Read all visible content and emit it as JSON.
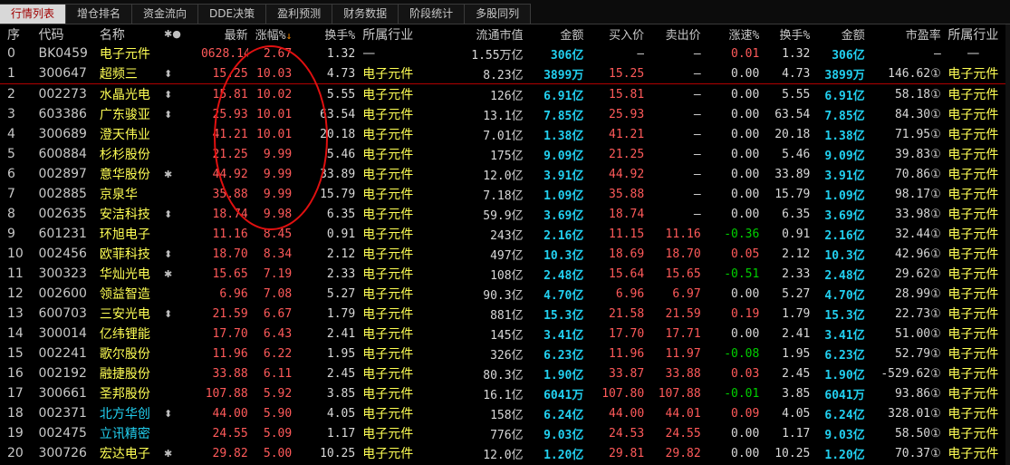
{
  "tabs": [
    {
      "label": "行情列表",
      "active": true
    },
    {
      "label": "增仓排名",
      "active": false
    },
    {
      "label": "资金流向",
      "active": false
    },
    {
      "label": "DDE决策",
      "active": false
    },
    {
      "label": "盈利预测",
      "active": false
    },
    {
      "label": "财务数据",
      "active": false
    },
    {
      "label": "阶段统计",
      "active": false
    },
    {
      "label": "多股同列",
      "active": false
    }
  ],
  "columns": [
    "序",
    "代码",
    "名称",
    "✱●",
    "最新",
    "涨幅%",
    "换手%",
    "所属行业",
    "流通市值",
    "金额",
    "买入价",
    "卖出价",
    "涨速%",
    "换手%",
    "金额",
    "市盈率",
    "所属行业"
  ],
  "sort_icon": "sort-desc-icon",
  "colors": {
    "red": "#ff5a5a",
    "green": "#00d000",
    "yellow": "#ffff54",
    "cyan": "#22d0f0",
    "circle": "#e01010"
  },
  "rows": [
    {
      "idx": "0",
      "code": "BK0459",
      "name": "电子元件",
      "mark": "",
      "price": "0628.14",
      "chg": "2.67",
      "turn": "1.32",
      "ind": "—",
      "mcap": "1.55万亿",
      "amt": "306亿",
      "bid": "—",
      "ask": "—",
      "speed": "0.01",
      "turn2": "1.32",
      "amt2": "306亿",
      "pe": "—",
      "ind2": "—"
    },
    {
      "idx": "1",
      "code": "300647",
      "name": "超频三",
      "mark": "⬍",
      "price": "15.25",
      "chg": "10.03",
      "turn": "4.73",
      "ind": "电子元件",
      "mcap": "8.23亿",
      "amt": "3899万",
      "bid": "15.25",
      "ask": "—",
      "speed": "0.00",
      "turn2": "4.73",
      "amt2": "3899万",
      "pe": "146.62①",
      "ind2": "电子元件"
    },
    {
      "idx": "2",
      "code": "002273",
      "name": "水晶光电",
      "mark": "⬍",
      "price": "15.81",
      "chg": "10.02",
      "turn": "5.55",
      "ind": "电子元件",
      "mcap": "126亿",
      "amt": "6.91亿",
      "bid": "15.81",
      "ask": "—",
      "speed": "0.00",
      "turn2": "5.55",
      "amt2": "6.91亿",
      "pe": "58.18①",
      "ind2": "电子元件"
    },
    {
      "idx": "3",
      "code": "603386",
      "name": "广东骏亚",
      "mark": "⬍",
      "price": "25.93",
      "chg": "10.01",
      "turn": "63.54",
      "ind": "电子元件",
      "mcap": "13.1亿",
      "amt": "7.85亿",
      "bid": "25.93",
      "ask": "—",
      "speed": "0.00",
      "turn2": "63.54",
      "amt2": "7.85亿",
      "pe": "84.30①",
      "ind2": "电子元件"
    },
    {
      "idx": "4",
      "code": "300689",
      "name": "澄天伟业",
      "mark": "",
      "price": "41.21",
      "chg": "10.01",
      "turn": "20.18",
      "ind": "电子元件",
      "mcap": "7.01亿",
      "amt": "1.38亿",
      "bid": "41.21",
      "ask": "—",
      "speed": "0.00",
      "turn2": "20.18",
      "amt2": "1.38亿",
      "pe": "71.95①",
      "ind2": "电子元件"
    },
    {
      "idx": "5",
      "code": "600884",
      "name": "杉杉股份",
      "mark": "",
      "price": "21.25",
      "chg": "9.99",
      "turn": "5.46",
      "ind": "电子元件",
      "mcap": "175亿",
      "amt": "9.09亿",
      "bid": "21.25",
      "ask": "—",
      "speed": "0.00",
      "turn2": "5.46",
      "amt2": "9.09亿",
      "pe": "39.83①",
      "ind2": "电子元件"
    },
    {
      "idx": "6",
      "code": "002897",
      "name": "意华股份",
      "mark": "✱",
      "price": "44.92",
      "chg": "9.99",
      "turn": "33.89",
      "ind": "电子元件",
      "mcap": "12.0亿",
      "amt": "3.91亿",
      "bid": "44.92",
      "ask": "—",
      "speed": "0.00",
      "turn2": "33.89",
      "amt2": "3.91亿",
      "pe": "70.86①",
      "ind2": "电子元件"
    },
    {
      "idx": "7",
      "code": "002885",
      "name": "京泉华",
      "mark": "",
      "price": "35.88",
      "chg": "9.99",
      "turn": "15.79",
      "ind": "电子元件",
      "mcap": "7.18亿",
      "amt": "1.09亿",
      "bid": "35.88",
      "ask": "—",
      "speed": "0.00",
      "turn2": "15.79",
      "amt2": "1.09亿",
      "pe": "98.17①",
      "ind2": "电子元件"
    },
    {
      "idx": "8",
      "code": "002635",
      "name": "安洁科技",
      "mark": "⬍",
      "price": "18.74",
      "chg": "9.98",
      "turn": "6.35",
      "ind": "电子元件",
      "mcap": "59.9亿",
      "amt": "3.69亿",
      "bid": "18.74",
      "ask": "—",
      "speed": "0.00",
      "turn2": "6.35",
      "amt2": "3.69亿",
      "pe": "33.98①",
      "ind2": "电子元件"
    },
    {
      "idx": "9",
      "code": "601231",
      "name": "环旭电子",
      "mark": "",
      "price": "11.16",
      "chg": "8.45",
      "turn": "0.91",
      "ind": "电子元件",
      "mcap": "243亿",
      "amt": "2.16亿",
      "bid": "11.15",
      "ask": "11.16",
      "speed": "-0.36",
      "turn2": "0.91",
      "amt2": "2.16亿",
      "pe": "32.44①",
      "ind2": "电子元件"
    },
    {
      "idx": "10",
      "code": "002456",
      "name": "欧菲科技",
      "mark": "⬍",
      "price": "18.70",
      "chg": "8.34",
      "turn": "2.12",
      "ind": "电子元件",
      "mcap": "497亿",
      "amt": "10.3亿",
      "bid": "18.69",
      "ask": "18.70",
      "speed": "0.05",
      "turn2": "2.12",
      "amt2": "10.3亿",
      "pe": "42.96①",
      "ind2": "电子元件"
    },
    {
      "idx": "11",
      "code": "300323",
      "name": "华灿光电",
      "mark": "✱",
      "price": "15.65",
      "chg": "7.19",
      "turn": "2.33",
      "ind": "电子元件",
      "mcap": "108亿",
      "amt": "2.48亿",
      "bid": "15.64",
      "ask": "15.65",
      "speed": "-0.51",
      "turn2": "2.33",
      "amt2": "2.48亿",
      "pe": "29.62①",
      "ind2": "电子元件"
    },
    {
      "idx": "12",
      "code": "002600",
      "name": "领益智造",
      "mark": "",
      "price": "6.96",
      "chg": "7.08",
      "turn": "5.27",
      "ind": "电子元件",
      "mcap": "90.3亿",
      "amt": "4.70亿",
      "bid": "6.96",
      "ask": "6.97",
      "speed": "0.00",
      "turn2": "5.27",
      "amt2": "4.70亿",
      "pe": "28.99①",
      "ind2": "电子元件"
    },
    {
      "idx": "13",
      "code": "600703",
      "name": "三安光电",
      "mark": "⬍",
      "price": "21.59",
      "chg": "6.67",
      "turn": "1.79",
      "ind": "电子元件",
      "mcap": "881亿",
      "amt": "15.3亿",
      "bid": "21.58",
      "ask": "21.59",
      "speed": "0.19",
      "turn2": "1.79",
      "amt2": "15.3亿",
      "pe": "22.73①",
      "ind2": "电子元件"
    },
    {
      "idx": "14",
      "code": "300014",
      "name": "亿纬锂能",
      "mark": "",
      "price": "17.70",
      "chg": "6.43",
      "turn": "2.41",
      "ind": "电子元件",
      "mcap": "145亿",
      "amt": "3.41亿",
      "bid": "17.70",
      "ask": "17.71",
      "speed": "0.00",
      "turn2": "2.41",
      "amt2": "3.41亿",
      "pe": "51.00①",
      "ind2": "电子元件"
    },
    {
      "idx": "15",
      "code": "002241",
      "name": "歌尔股份",
      "mark": "",
      "price": "11.96",
      "chg": "6.22",
      "turn": "1.95",
      "ind": "电子元件",
      "mcap": "326亿",
      "amt": "6.23亿",
      "bid": "11.96",
      "ask": "11.97",
      "speed": "-0.08",
      "turn2": "1.95",
      "amt2": "6.23亿",
      "pe": "52.79①",
      "ind2": "电子元件"
    },
    {
      "idx": "16",
      "code": "002192",
      "name": "融捷股份",
      "mark": "",
      "price": "33.88",
      "chg": "6.11",
      "turn": "2.45",
      "ind": "电子元件",
      "mcap": "80.3亿",
      "amt": "1.90亿",
      "bid": "33.87",
      "ask": "33.88",
      "speed": "0.03",
      "turn2": "2.45",
      "amt2": "1.90亿",
      "pe": "-529.62①",
      "ind2": "电子元件"
    },
    {
      "idx": "17",
      "code": "300661",
      "name": "圣邦股份",
      "mark": "",
      "price": "107.88",
      "chg": "5.92",
      "turn": "3.85",
      "ind": "电子元件",
      "mcap": "16.1亿",
      "amt": "6041万",
      "bid": "107.80",
      "ask": "107.88",
      "speed": "-0.01",
      "turn2": "3.85",
      "amt2": "6041万",
      "pe": "93.86①",
      "ind2": "电子元件"
    },
    {
      "idx": "18",
      "code": "002371",
      "name": "北方华创",
      "mark": "⬍",
      "price": "44.00",
      "chg": "5.90",
      "turn": "4.05",
      "ind": "电子元件",
      "mcap": "158亿",
      "amt": "6.24亿",
      "bid": "44.00",
      "ask": "44.01",
      "speed": "0.09",
      "turn2": "4.05",
      "amt2": "6.24亿",
      "pe": "328.01①",
      "ind2": "电子元件"
    },
    {
      "idx": "19",
      "code": "002475",
      "name": "立讯精密",
      "mark": "",
      "price": "24.55",
      "chg": "5.09",
      "turn": "1.17",
      "ind": "电子元件",
      "mcap": "776亿",
      "amt": "9.03亿",
      "bid": "24.53",
      "ask": "24.55",
      "speed": "0.00",
      "turn2": "1.17",
      "amt2": "9.03亿",
      "pe": "58.50①",
      "ind2": "电子元件"
    },
    {
      "idx": "20",
      "code": "300726",
      "name": "宏达电子",
      "mark": "✱",
      "price": "29.82",
      "chg": "5.00",
      "turn": "10.25",
      "ind": "电子元件",
      "mcap": "12.0亿",
      "amt": "1.20亿",
      "bid": "29.81",
      "ask": "29.82",
      "speed": "0.00",
      "turn2": "10.25",
      "amt2": "1.20亿",
      "pe": "70.37①",
      "ind2": "电子元件"
    }
  ]
}
